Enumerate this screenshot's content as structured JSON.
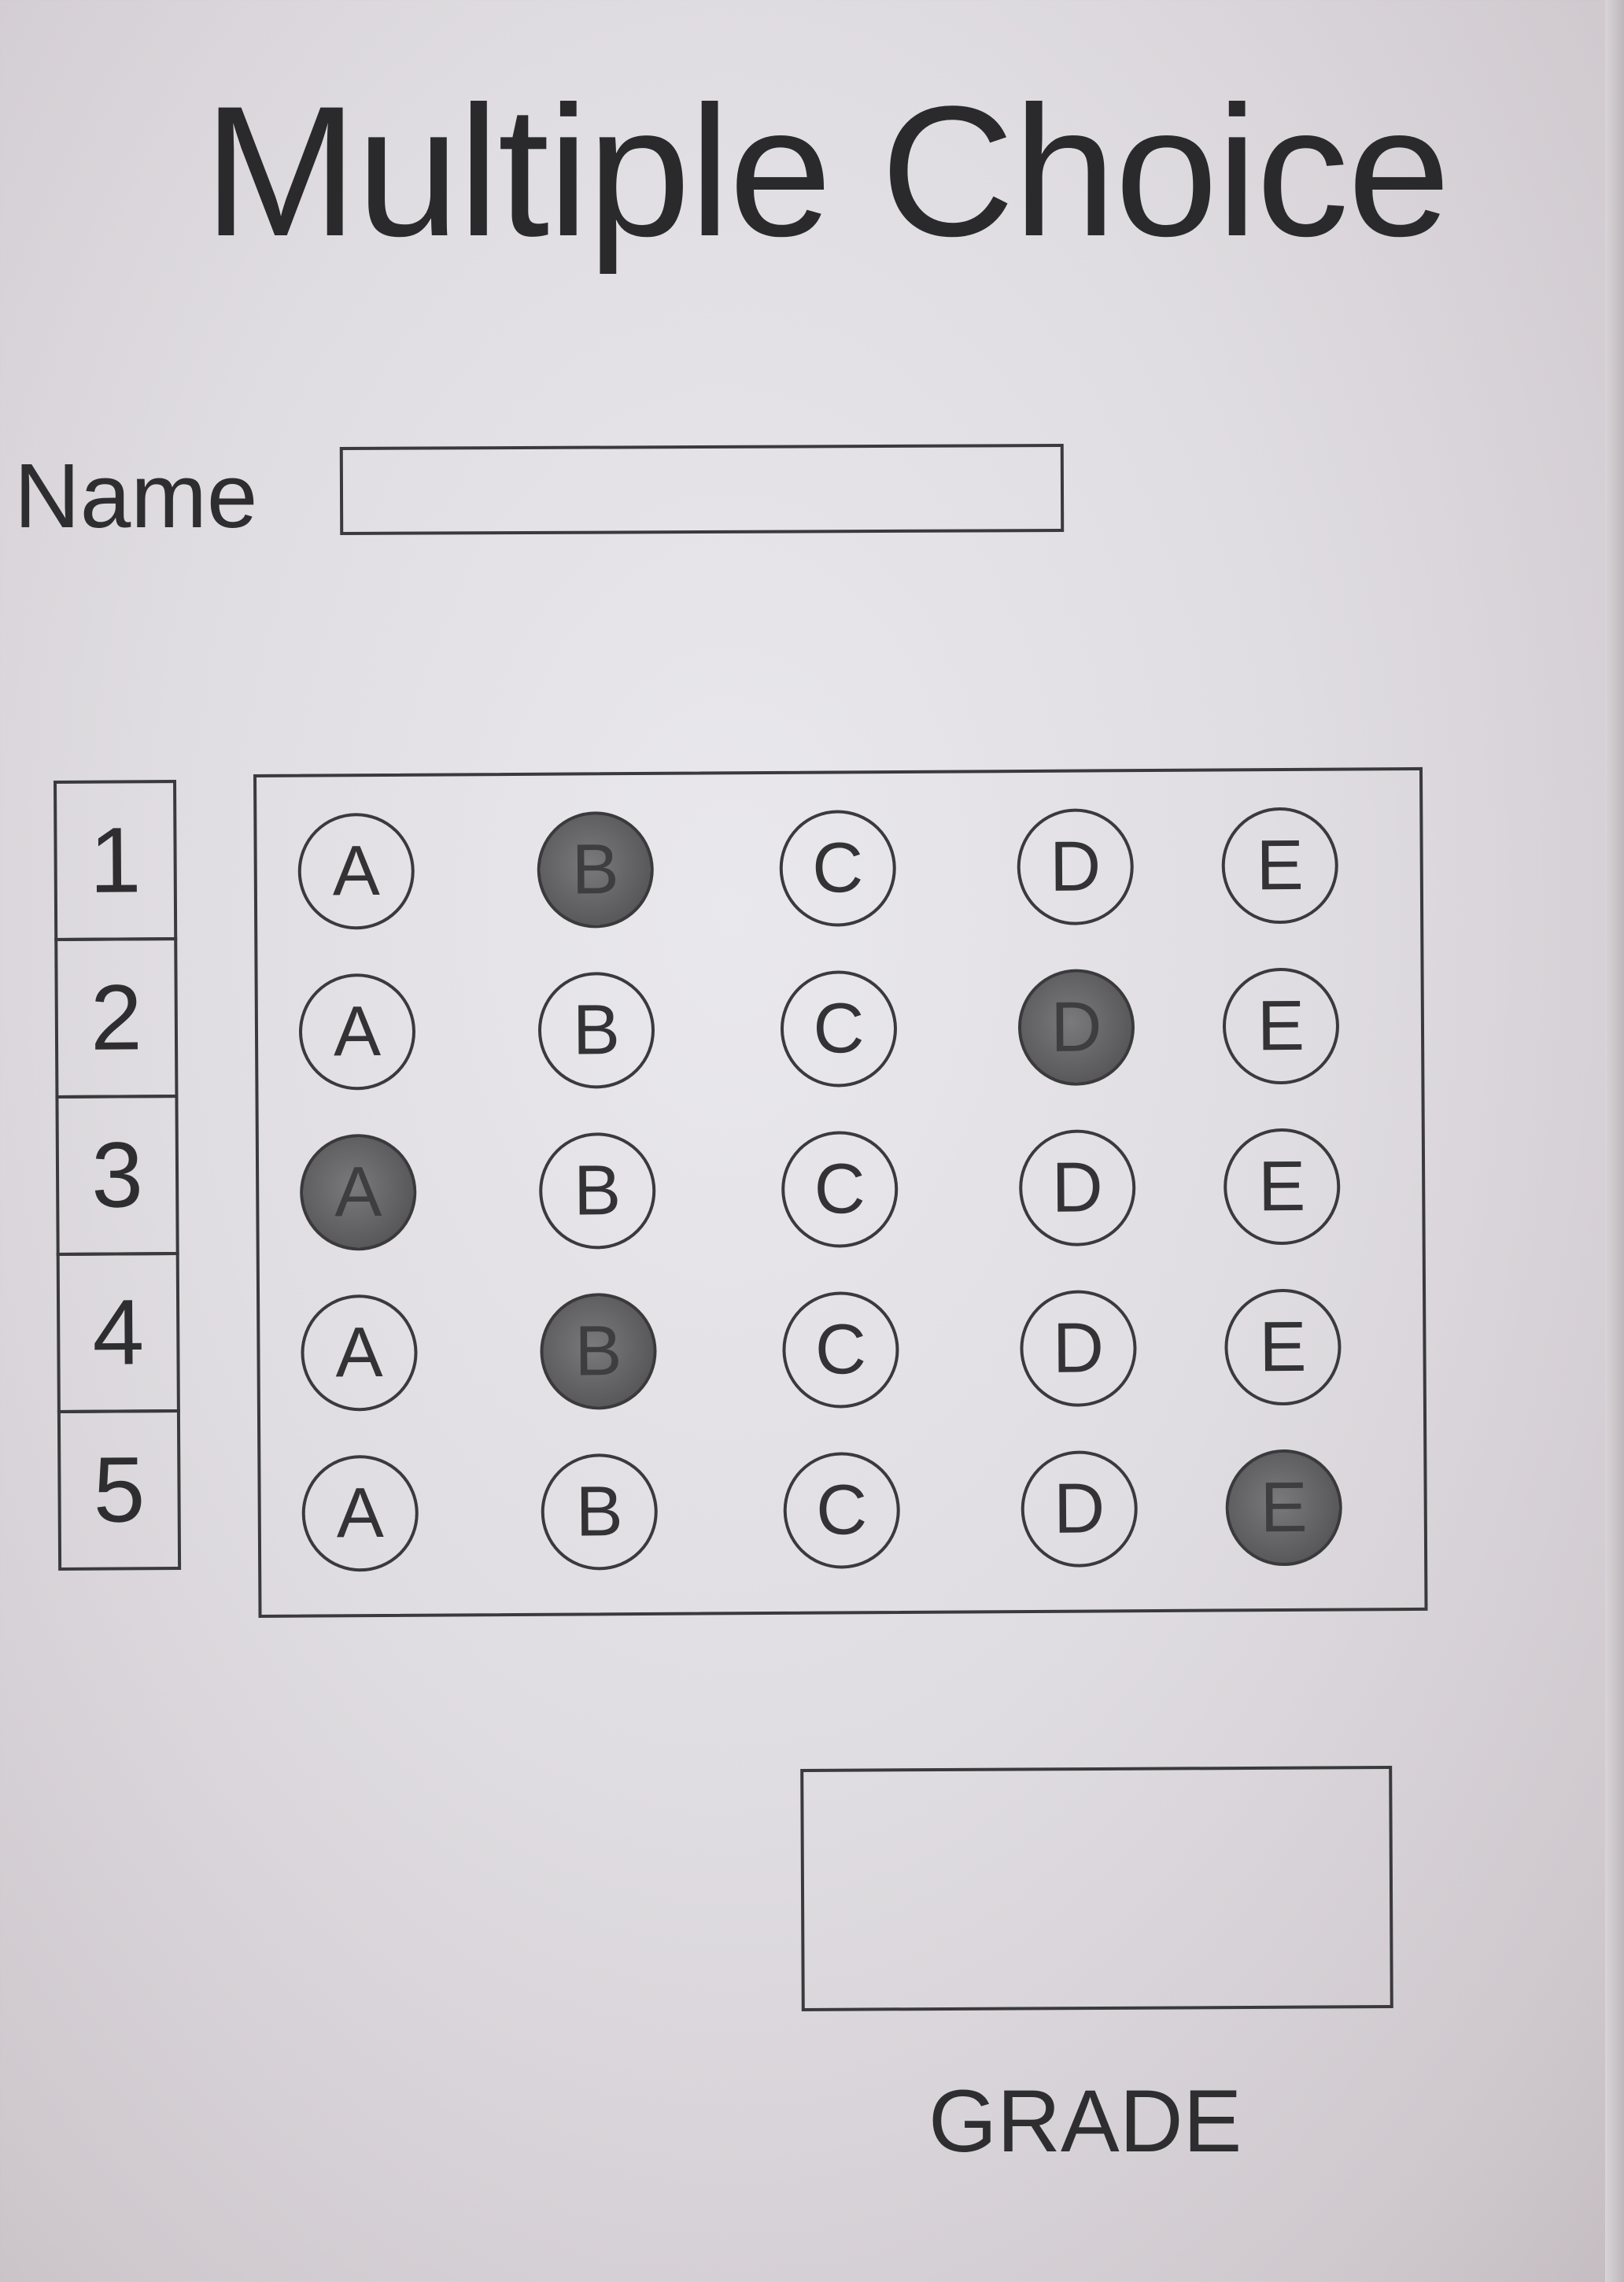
{
  "title": "Multiple Choice",
  "name": {
    "label": "Name",
    "value": ""
  },
  "questions": [
    {
      "number": "1",
      "options": [
        "A",
        "B",
        "C",
        "D",
        "E"
      ],
      "marked": "B"
    },
    {
      "number": "2",
      "options": [
        "A",
        "B",
        "C",
        "D",
        "E"
      ],
      "marked": "D"
    },
    {
      "number": "3",
      "options": [
        "A",
        "B",
        "C",
        "D",
        "E"
      ],
      "marked": "A"
    },
    {
      "number": "4",
      "options": [
        "A",
        "B",
        "C",
        "D",
        "E"
      ],
      "marked": "B"
    },
    {
      "number": "5",
      "options": [
        "A",
        "B",
        "C",
        "D",
        "E"
      ],
      "marked": "E"
    }
  ],
  "grade": {
    "label": "GRADE",
    "value": ""
  }
}
